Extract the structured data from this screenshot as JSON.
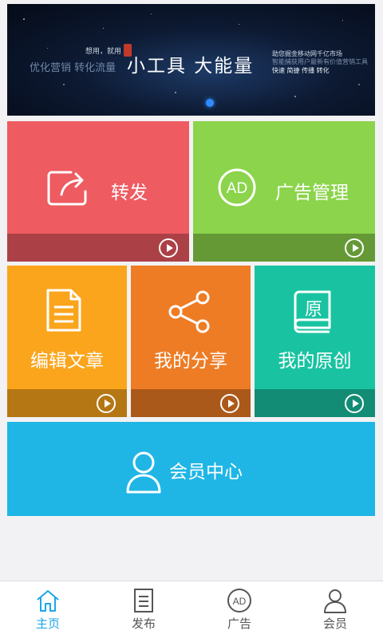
{
  "banner": {
    "slogan": "优化营销  转化流量",
    "tagline": "想用，就用",
    "title": "小工具 大能量",
    "desc_line1": "助您掘金移动网千亿市场",
    "desc_line2": "智能捕获用户最新有价值营销工具",
    "desc_keys": "快速  简捷  传播  转化"
  },
  "tiles": {
    "forward": {
      "label": "转发",
      "icon": "share-out-icon",
      "color": "#ee5b61"
    },
    "ad": {
      "label": "广告管理",
      "icon": "ad-icon",
      "color": "#8bd44b"
    },
    "edit": {
      "label": "编辑文章",
      "icon": "document-icon",
      "color": "#fba51c"
    },
    "share": {
      "label": "我的分享",
      "icon": "share-nodes-icon",
      "color": "#ee7c25"
    },
    "original": {
      "label": "我的原创",
      "icon": "book-icon",
      "color": "#19c3a1",
      "badge": "原"
    },
    "member": {
      "label": "会员中心",
      "icon": "user-icon",
      "color": "#1fb6e6"
    }
  },
  "tabbar": {
    "home": "主页",
    "publish": "发布",
    "ad": "广告",
    "member": "会员",
    "ad_icon_text": "AD",
    "active_color": "#1aa7e8"
  }
}
